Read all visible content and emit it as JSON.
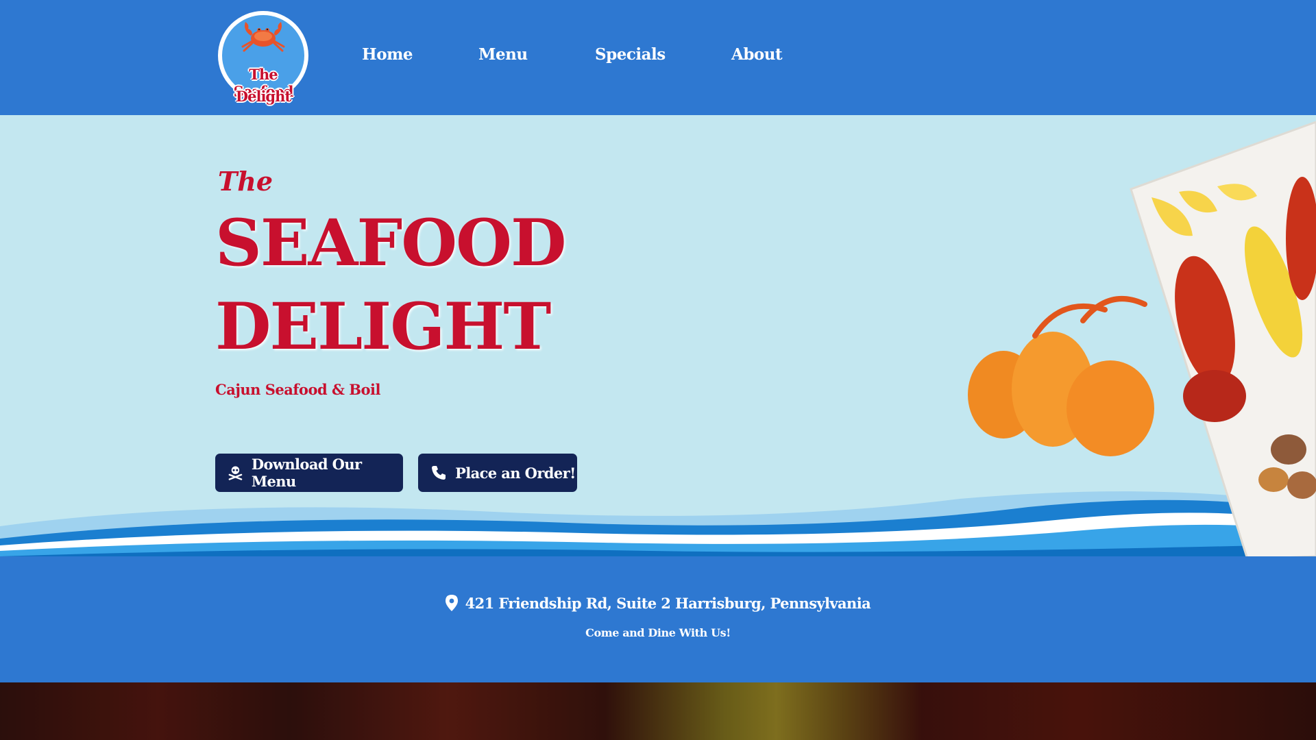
{
  "brand": {
    "logo_line1": "The Seafood",
    "logo_line2": "Delight",
    "colors": {
      "nav_blue": "#2e78d1",
      "hero_bg": "#c3e7f0",
      "brand_red": "#c8102e",
      "button_navy": "#132456"
    }
  },
  "nav": {
    "items": [
      {
        "label": "Home"
      },
      {
        "label": "Menu"
      },
      {
        "label": "Specials"
      },
      {
        "label": "About"
      }
    ]
  },
  "hero": {
    "kicker": "The",
    "title_line1": "SEAFOOD",
    "title_line2": "DELIGHT",
    "subtitle": "Cajun Seafood & Boil",
    "buttons": [
      {
        "label": "Download Our Menu",
        "icon": "skull-crossbones-icon"
      },
      {
        "label": "Place an Order!",
        "icon": "phone-icon"
      }
    ]
  },
  "info": {
    "address": "421 Friendship Rd, Suite 2 Harrisburg, Pennsylvania",
    "address_icon": "map-pin-icon",
    "tagline": "Come and Dine With Us!"
  }
}
